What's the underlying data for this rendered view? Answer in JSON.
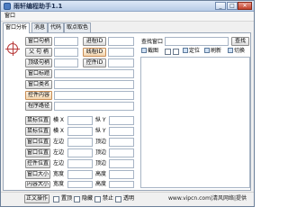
{
  "window": {
    "title": "雨轩编程助手1.1",
    "minimize": "_",
    "maximize": "□",
    "close": "✕"
  },
  "menu": {
    "items": [
      "窗口"
    ]
  },
  "tabs": [
    "窗口分析",
    "消息",
    "代码",
    "取点取色"
  ],
  "left_buttons": [
    "窗口句柄",
    "父 句 柄",
    "顶级句柄",
    "窗口标题",
    "窗口类名",
    "控件内容",
    "程序路径"
  ],
  "mid_buttons": [
    "进程ID",
    "线程ID",
    "控件ID"
  ],
  "pos_buttons": [
    "鼠标位置",
    "鼠标位置",
    "窗口位置",
    "窗口位置",
    "控件位置",
    "窗口大小",
    "内容大小"
  ],
  "pos_labels_left": [
    "横 X",
    "横 X",
    "左边",
    "左边",
    "左边",
    "宽度",
    "宽度"
  ],
  "pos_labels_right": [
    "纵 Y",
    "纵 Y",
    "顶边",
    "顶边",
    "顶边",
    "高度",
    "高度"
  ],
  "bottom": {
    "button": "正文操作",
    "checkboxes": [
      "置顶",
      "隐藏",
      "禁止",
      "透明"
    ]
  },
  "search": {
    "label": "查找窗口",
    "button": "查找"
  },
  "toolbar": {
    "items": [
      "截图",
      "定位",
      "刷新",
      "切换"
    ]
  },
  "status": {
    "watermark": "www.vipcn.com|清风网络|提供"
  },
  "colors": {
    "title_gradient_top": "#dde8f7",
    "highlight_button": "#f3d6b0",
    "close_button": "#c2412a"
  },
  "icons": [
    "app-icon",
    "crosshair-icon",
    "screenshot-icon",
    "locate-icon",
    "refresh-icon",
    "switch-icon"
  ]
}
